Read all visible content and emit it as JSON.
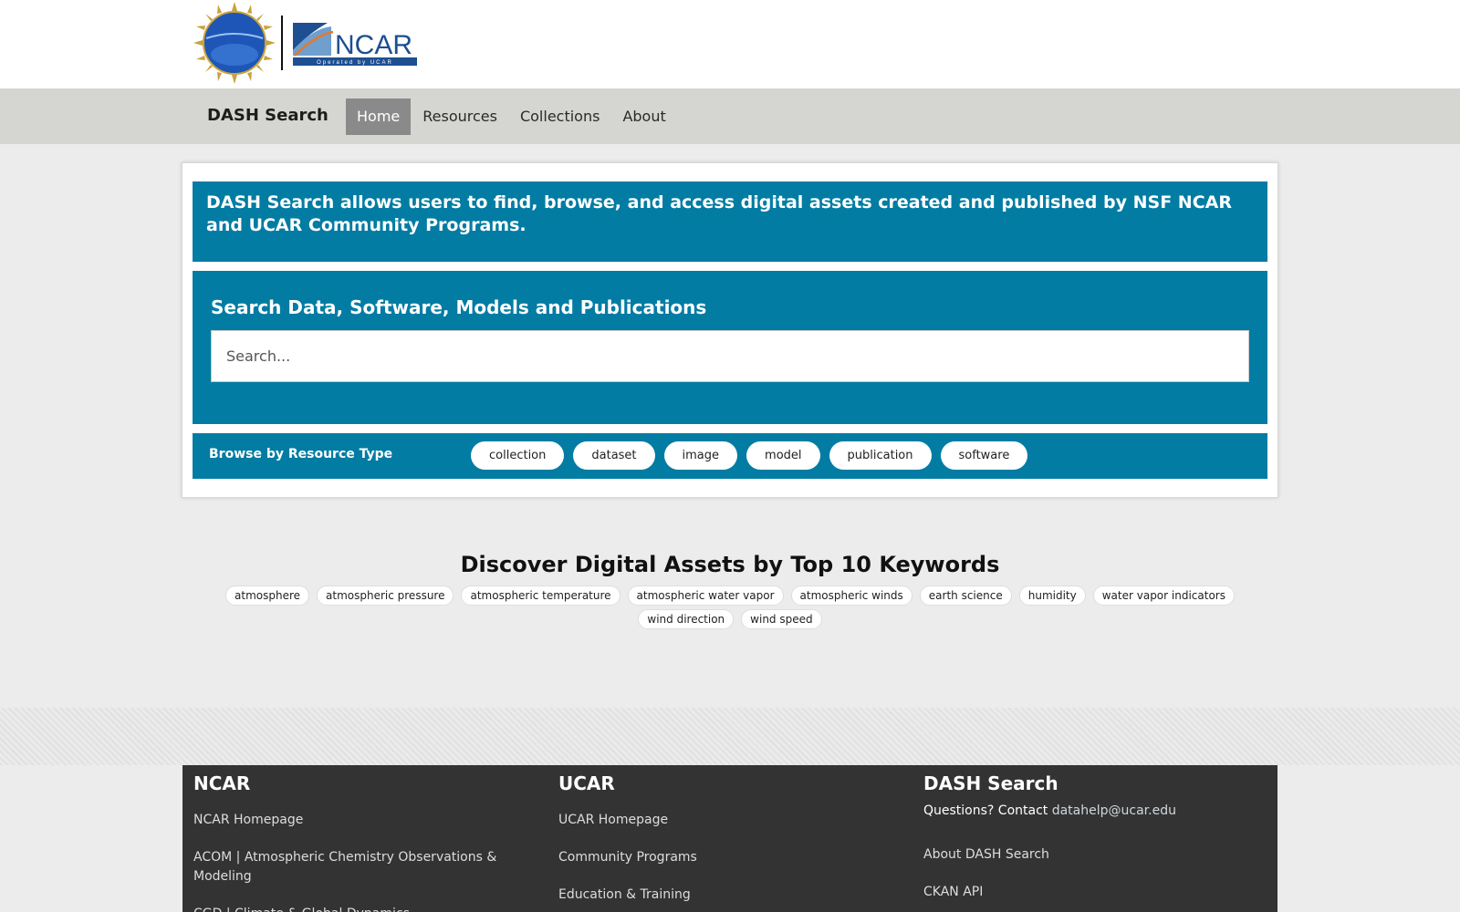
{
  "header": {
    "logos": [
      "NSF",
      "NCAR"
    ],
    "ncar_tagline": "Operated by UCAR"
  },
  "nav": {
    "brand": "DASH Search",
    "items": [
      {
        "label": "Home",
        "active": true
      },
      {
        "label": "Resources",
        "active": false
      },
      {
        "label": "Collections",
        "active": false
      },
      {
        "label": "About",
        "active": false
      }
    ]
  },
  "intro": {
    "text": "DASH Search allows users to find, browse, and access digital assets created and published by NSF NCAR and UCAR Community Programs."
  },
  "search": {
    "title": "Search Data, Software, Models and Publications",
    "placeholder": "Search..."
  },
  "browse": {
    "label": "Browse by Resource Type",
    "types": [
      "collection",
      "dataset",
      "image",
      "model",
      "publication",
      "software"
    ]
  },
  "keywords": {
    "title": "Discover Digital Assets by Top 10 Keywords",
    "row1": [
      "atmosphere",
      "atmospheric pressure",
      "atmospheric temperature",
      "atmospheric water vapor",
      "atmospheric winds",
      "earth science",
      "humidity",
      "water vapor indicators"
    ],
    "row2": [
      "wind direction",
      "wind speed"
    ]
  },
  "footer": {
    "ncar": {
      "title": "NCAR",
      "links": [
        "NCAR Homepage",
        "ACOM | Atmospheric Chemistry Observations & Modeling",
        "CGD | Climate & Global Dynamics"
      ]
    },
    "ucar": {
      "title": "UCAR",
      "links": [
        "UCAR Homepage",
        "Community Programs",
        "Education & Training"
      ]
    },
    "dash": {
      "title": "DASH Search",
      "contact_label": "Questions? Contact",
      "contact_email": "datahelp@ucar.edu",
      "links": [
        "About DASH Search",
        "CKAN API"
      ]
    }
  },
  "colors": {
    "accent": "#027ca3",
    "navbar": "#d5d5d1",
    "nav_active": "#8a8a8a",
    "footer": "#333333"
  }
}
